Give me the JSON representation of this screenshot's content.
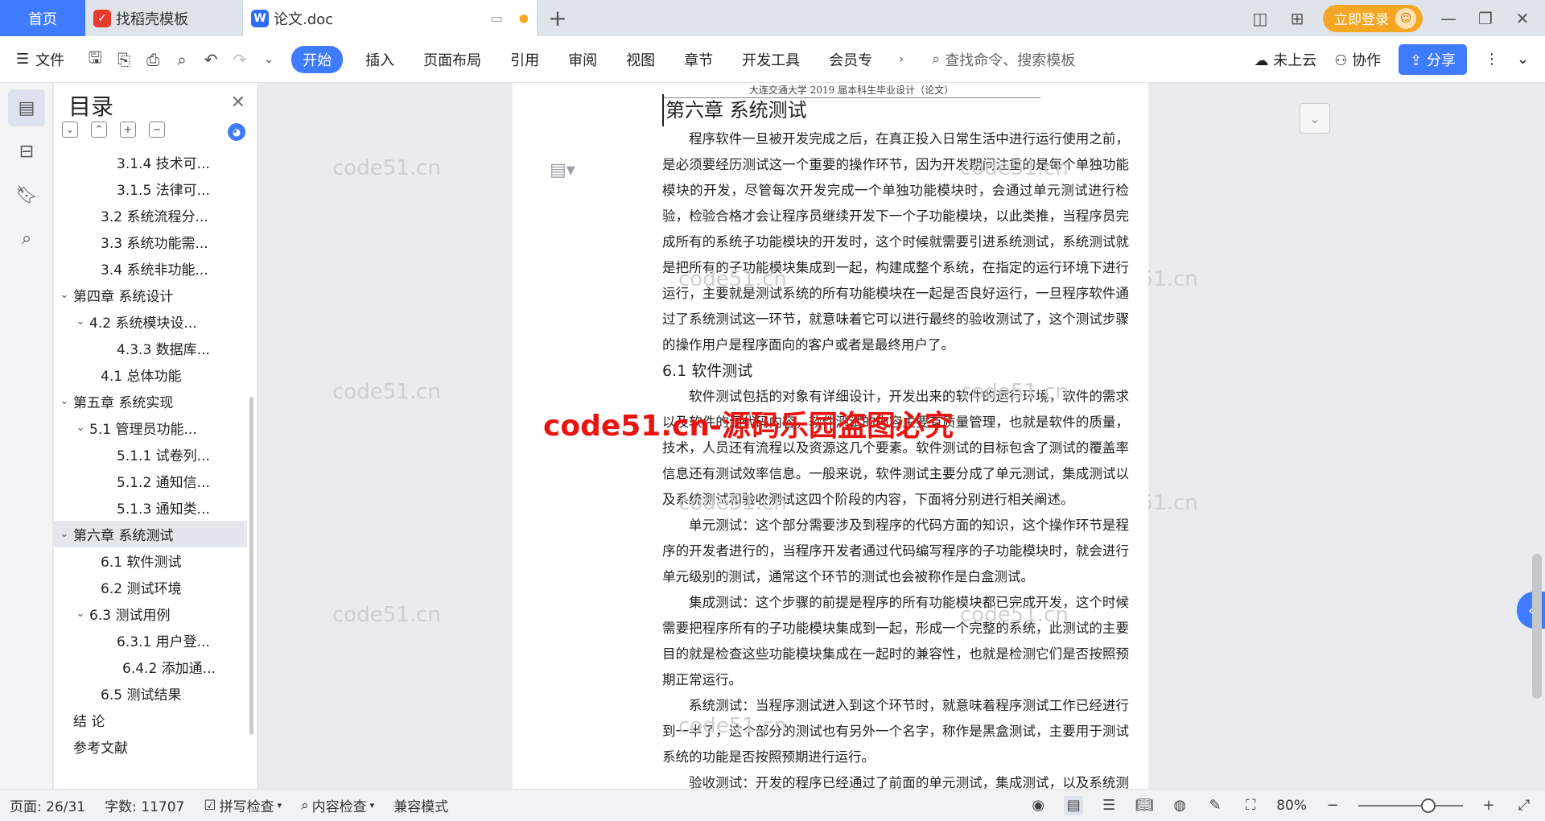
{
  "tabs": {
    "home": "首页",
    "template": "找稻壳模板",
    "doc": "论文.doc"
  },
  "titlebar": {
    "login": "立即登录"
  },
  "toolbar": {
    "file": "文件",
    "menus": [
      "开始",
      "插入",
      "页面布局",
      "引用",
      "审阅",
      "视图",
      "章节",
      "开发工具",
      "会员专"
    ],
    "search_placeholder": "查找命令、搜索模板",
    "cloud": "未上云",
    "collab": "协作",
    "share": "分享"
  },
  "toc": {
    "title": "目录",
    "items": [
      {
        "label": "3.1.4  技术可...",
        "level": 3,
        "arrow": ""
      },
      {
        "label": "3.1.5  法律可...",
        "level": 3,
        "arrow": ""
      },
      {
        "label": "3.2 系统流程分...",
        "level": 2,
        "arrow": ""
      },
      {
        "label": "3.3 系统功能需...",
        "level": 2,
        "arrow": ""
      },
      {
        "label": "3.4  系统非功能...",
        "level": 2,
        "arrow": ""
      },
      {
        "label": "第四章  系统设计",
        "level": 1,
        "arrow": "⌄"
      },
      {
        "label": "4.2  系统模块设...",
        "level": 2,
        "arrow": "⌄"
      },
      {
        "label": "4.3.3  数据库...",
        "level": 3,
        "arrow": ""
      },
      {
        "label": "4.1  总体功能",
        "level": 2,
        "arrow": ""
      },
      {
        "label": "第五章  系统实现",
        "level": 1,
        "arrow": "⌄"
      },
      {
        "label": "5.1  管理员功能...",
        "level": 2,
        "arrow": "⌄"
      },
      {
        "label": "5.1.1  试卷列...",
        "level": 3,
        "arrow": ""
      },
      {
        "label": "5.1.2  通知信...",
        "level": 3,
        "arrow": ""
      },
      {
        "label": "5.1.3  通知类...",
        "level": 3,
        "arrow": ""
      },
      {
        "label": "第六章  系统测试",
        "level": 1,
        "arrow": "⌄",
        "selected": true
      },
      {
        "label": "6.1 软件测试",
        "level": 2,
        "arrow": ""
      },
      {
        "label": "6.2 测试环境",
        "level": 2,
        "arrow": ""
      },
      {
        "label": "6.3  测试用例",
        "level": 2,
        "arrow": "⌄"
      },
      {
        "label": "6.3.1  用户登...",
        "level": 3,
        "arrow": ""
      },
      {
        "label": "6.4.2  添加通...",
        "level": 3.3,
        "arrow": ""
      },
      {
        "label": "6.5 测试结果",
        "level": 2,
        "arrow": ""
      },
      {
        "label": "结    论",
        "level": 1,
        "arrow": ""
      },
      {
        "label": "参考文献",
        "level": 1,
        "arrow": ""
      }
    ]
  },
  "document": {
    "header": "大连交通大学 2019 届本科生毕业设计（论文）",
    "chapter": "第六章  系统测试",
    "section": "6.1 软件测试",
    "p1": "程序软件一旦被开发完成之后，在真正投入日常生活中进行运行使用之前，是必须要经历测试这一个重要的操作环节，因为开发期间注重的是每个单独功能模块的开发，尽管每次开发完成一个单独功能模块时，会通过单元测试进行检验，检验合格才会让程序员继续开发下一个子功能模块，以此类推，当程序员完成所有的系统子功能模块的开发时，这个时候就需要引进系统测试，系统测试就是把所有的子功能模块集成到一起，构建成整个系统，在指定的运行环境下进行运行，主要就是测试系统的所有功能模块在一起是否良好运行，一旦程序软件通过了系统测试这一环节，就意味着它可以进行最终的验收测试了，这个测试步骤的操作用户是程序面向的客户或者是最终用户了。",
    "p2": "软件测试包括的对象有详细设计，开发出来的软件的运行环境，软件的需求以及软件的源代码内容，软件测试的内容主要有质量管理，也就是软件的质量，技术，人员还有流程以及资源这几个要素。软件测试的目标包含了测试的覆盖率信息还有测试效率信息。一般来说，软件测试主要分成了单元测试，集成测试以及系统测试和验收测试这四个阶段的内容，下面将分别进行相关阐述。",
    "p3": "单元测试：这个部分需要涉及到程序的代码方面的知识，这个操作环节是程序的开发者进行的，当程序开发者通过代码编写程序的子功能模块时，就会进行单元级别的测试，通常这个环节的测试也会被称作是白盒测试。",
    "p4": "集成测试：这个步骤的前提是程序的所有功能模块都已完成开发，这个时候需要把程序所有的子功能模块集成到一起，形成一个完整的系统，此测试的主要目的就是检查这些功能模块集成在一起时的兼容性，也就是检测它们是否按照预期正常运行。",
    "p5": "系统测试：当程序测试进入到这个环节时，就意味着程序测试工作已经进行到一半了，这个部分的测试也有另外一个名字，称作是黑盒测试，主要用于测试系统的功能是否按照预期进行运行。",
    "p6": "验收测试：开发的程序已经通过了前面的单元测试，集成测试，以及系统测试环节时，就需要进行验收了，这个环节的操作用户就是程序面临的最终用户或者是客户。"
  },
  "watermark": {
    "text": "code51.cn",
    "banner": "code51.cn-源码乐园盗图必究"
  },
  "status": {
    "page": "页面: 26/31",
    "words": "字数: 11707",
    "spell": "拼写检查",
    "content_check": "内容检查",
    "compat": "兼容模式",
    "zoom": "80%"
  },
  "colors": {
    "accent": "#3f7bff",
    "login": "#f5a623",
    "banner": "#e8140f"
  }
}
